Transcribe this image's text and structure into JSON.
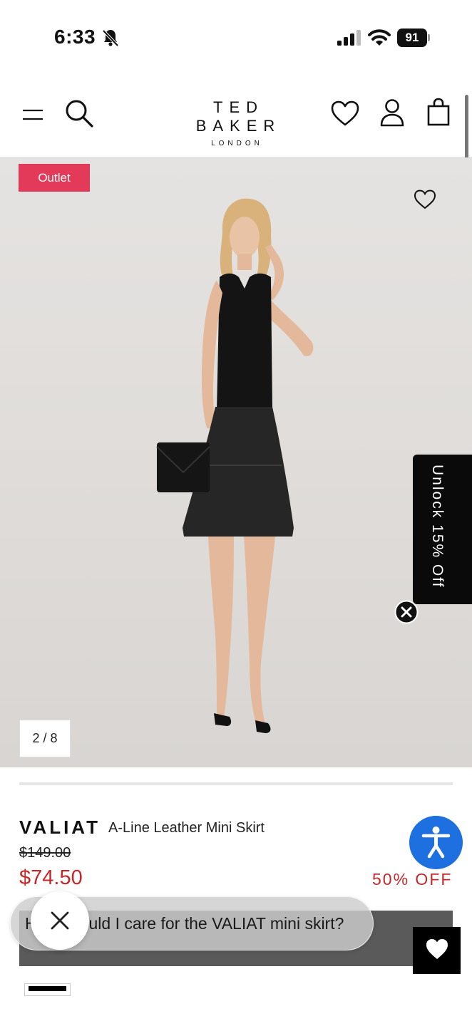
{
  "status_bar": {
    "time": "6:33",
    "battery": "91",
    "icons": [
      "bell-slash-icon",
      "signal-icon",
      "wifi-icon",
      "battery-icon"
    ]
  },
  "header": {
    "logo_main": "TED BAKER",
    "logo_sub": "LONDON",
    "icons": [
      "menu-icon",
      "search-icon",
      "wishlist-icon",
      "account-icon",
      "bag-icon"
    ]
  },
  "gallery": {
    "badge": "Outlet",
    "counter": "2 / 8",
    "badge_color": "#e33a59"
  },
  "promo_tab": {
    "label": "Unlock 15% Off"
  },
  "product": {
    "brand": "VALIAT",
    "name": "A-Line Leather Mini Skirt",
    "price_original": "$149.00",
    "price_sale": "$74.50",
    "discount": "50% OFF",
    "sale_color": "#c62828"
  },
  "assistant": {
    "question": "How should I care for the VALIAT mini skirt?"
  },
  "accessibility": {
    "color": "#1e6fe0"
  }
}
